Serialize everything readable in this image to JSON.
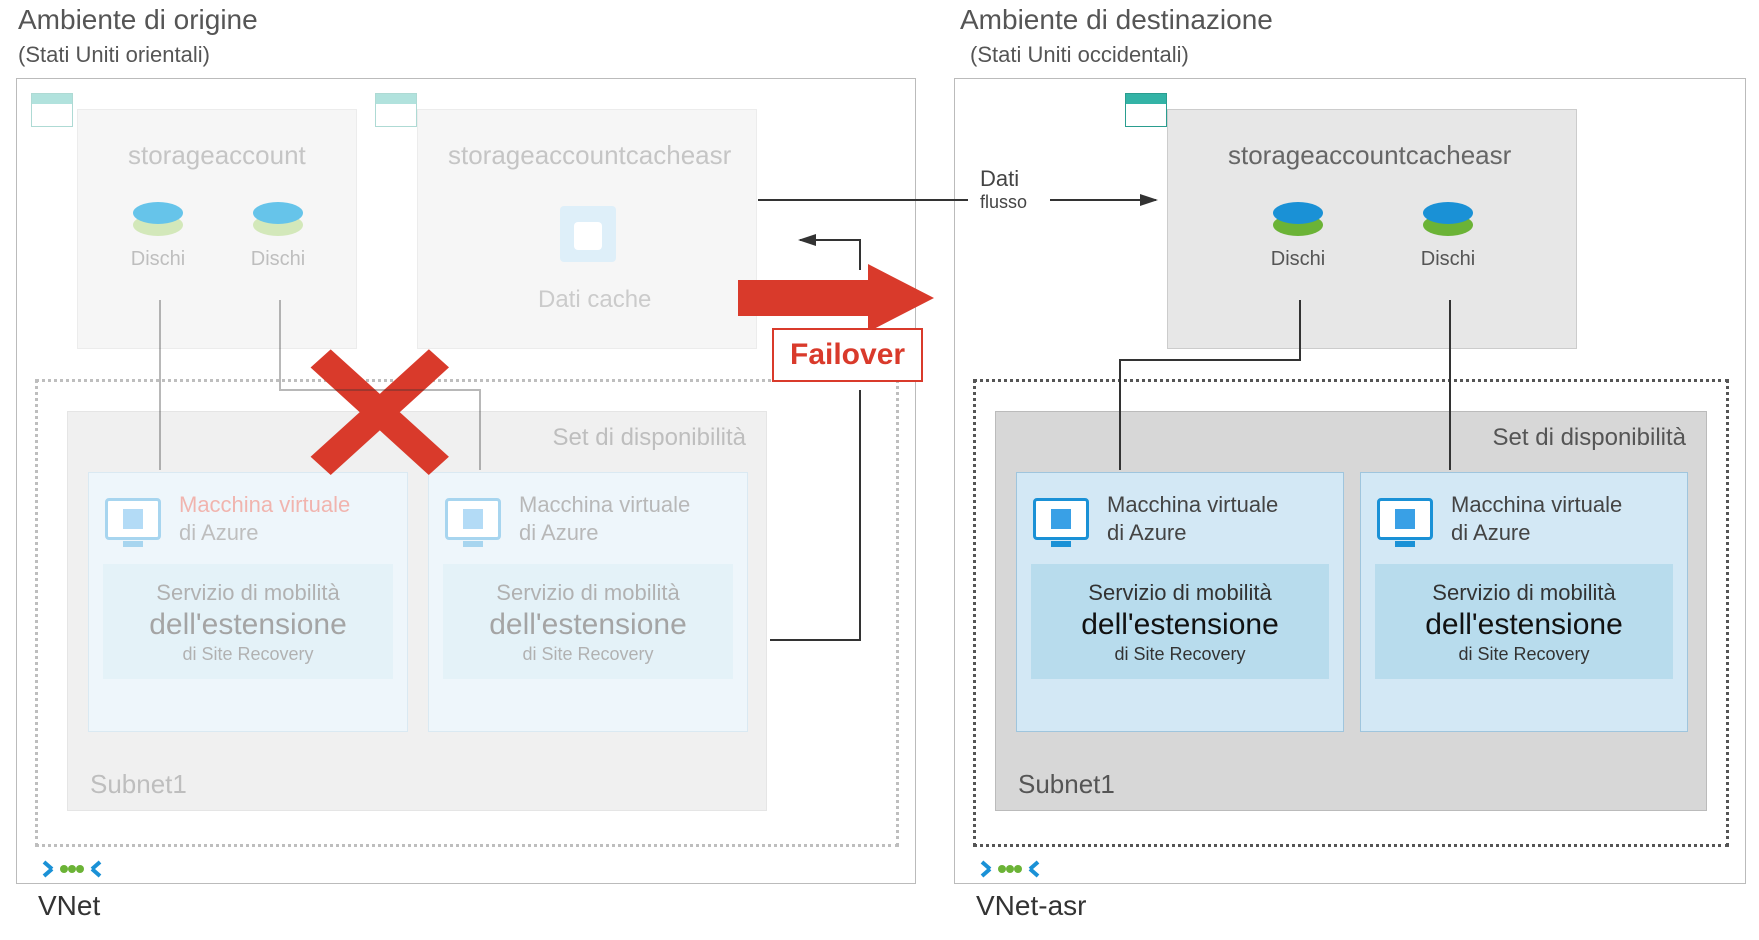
{
  "source": {
    "title": "Ambiente di origine",
    "subtitle": "(Stati Uniti orientali)",
    "storage1": {
      "name": "storageaccount",
      "disk_label": "Dischi"
    },
    "storage2": {
      "name": "storageaccountcacheasr",
      "cache_label": "Dati cache"
    },
    "avail_title": "Set di disponibilità",
    "vm1": {
      "title_l1": "Macchina virtuale",
      "title_l2": "di Azure"
    },
    "vm2": {
      "title_l1": "Macchina virtuale",
      "title_l2": "di Azure"
    },
    "svc": {
      "l1": "Servizio di mobilità",
      "l2": "dell'estensione",
      "l3": "di Site Recovery"
    },
    "subnet": "Subnet1",
    "vnet": "VNet"
  },
  "target": {
    "title": "Ambiente di destinazione",
    "subtitle": "(Stati Uniti occidentali)",
    "storage": {
      "name": "storageaccountcacheasr",
      "disk_label": "Dischi"
    },
    "avail_title": "Set di disponibilità",
    "vm1": {
      "title_l1": "Macchina virtuale",
      "title_l2": "di Azure"
    },
    "vm2": {
      "title_l1": "Macchina virtuale",
      "title_l2": "di Azure"
    },
    "svc": {
      "l1": "Servizio di mobilità",
      "l2": "dell'estensione",
      "l3": "di Site Recovery"
    },
    "subnet": "Subnet1",
    "vnet": "VNet-asr"
  },
  "flow": {
    "label": "Dati",
    "sub": "flusso"
  },
  "failover": "Failover"
}
